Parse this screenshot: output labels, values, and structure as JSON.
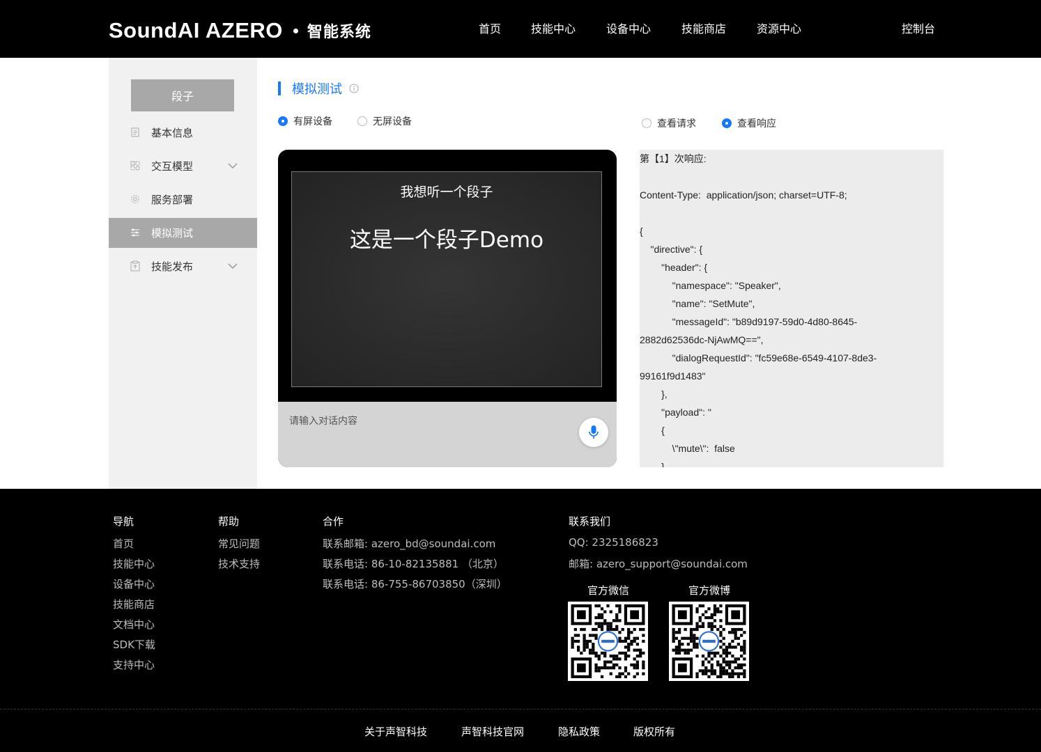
{
  "header": {
    "logo_main": "SoundAI AZERO",
    "logo_sub": "智能系统",
    "nav": [
      "首页",
      "技能中心",
      "设备中心",
      "技能商店",
      "资源中心"
    ],
    "console": "控制台"
  },
  "sidebar": {
    "skill_name": "段子",
    "items": [
      {
        "label": "基本信息",
        "icon": "document-icon"
      },
      {
        "label": "交互模型",
        "icon": "model-icon"
      },
      {
        "label": "服务部署",
        "icon": "gear-icon"
      },
      {
        "label": "模拟测试",
        "icon": "sliders-icon"
      },
      {
        "label": "技能发布",
        "icon": "clipboard-icon"
      }
    ],
    "active": "模拟测试"
  },
  "main": {
    "title": "模拟测试",
    "device_options": [
      "有屏设备",
      "无屏设备"
    ],
    "device_selected": "有屏设备",
    "view_options": [
      "查看请求",
      "查看响应"
    ],
    "view_selected": "查看响应",
    "screen_query": "我想听一个段子",
    "screen_answer": "这是一个段子Demo",
    "input_placeholder": "请输入对话内容",
    "response_lines": [
      "第【1】次响应:",
      "",
      "Content-Type:  application/json; charset=UTF-8;",
      "",
      "{",
      "    \"directive\": {",
      "        \"header\": {",
      "            \"namespace\": \"Speaker\",",
      "            \"name\": \"SetMute\",",
      "            \"messageId\": \"b89d9197-59d0-4d80-8645-",
      "2882d62536dc-NjAwMQ==\",",
      "            \"dialogRequestId\": \"fc59e68e-6549-4107-8de3-",
      "99161f9d1483\"",
      "        },",
      "        \"payload\": \"",
      "        {",
      "            \\\"mute\\\":  false",
      "        }"
    ]
  },
  "footer": {
    "nav_title": "导航",
    "nav_links": [
      "首页",
      "技能中心",
      "设备中心",
      "技能商店",
      "文档中心",
      "SDK下载",
      "支持中心"
    ],
    "help_title": "帮助",
    "help_links": [
      "常见问题",
      "技术支持"
    ],
    "coop_title": "合作",
    "coop_lines": [
      "联系邮箱:  azero_bd@soundai.com",
      "联系电话:  86-10-82135881 （北京）",
      "联系电话:  86-755-86703850（深圳）"
    ],
    "contact_title": "联系我们",
    "contact_lines": [
      "QQ:  2325186823",
      "邮箱:  azero_support@soundai.com"
    ],
    "qr_wechat_label": "官方微信",
    "qr_weibo_label": "官方微博",
    "bottom_links": [
      "关于声智科技",
      "声智科技官网",
      "隐私政策",
      "版权所有"
    ]
  },
  "colors": {
    "accent": "#1677ff",
    "header_bg": "#000000",
    "sidebar_bg": "#f1f1f1",
    "active_item_bg": "#a8a8a8"
  }
}
